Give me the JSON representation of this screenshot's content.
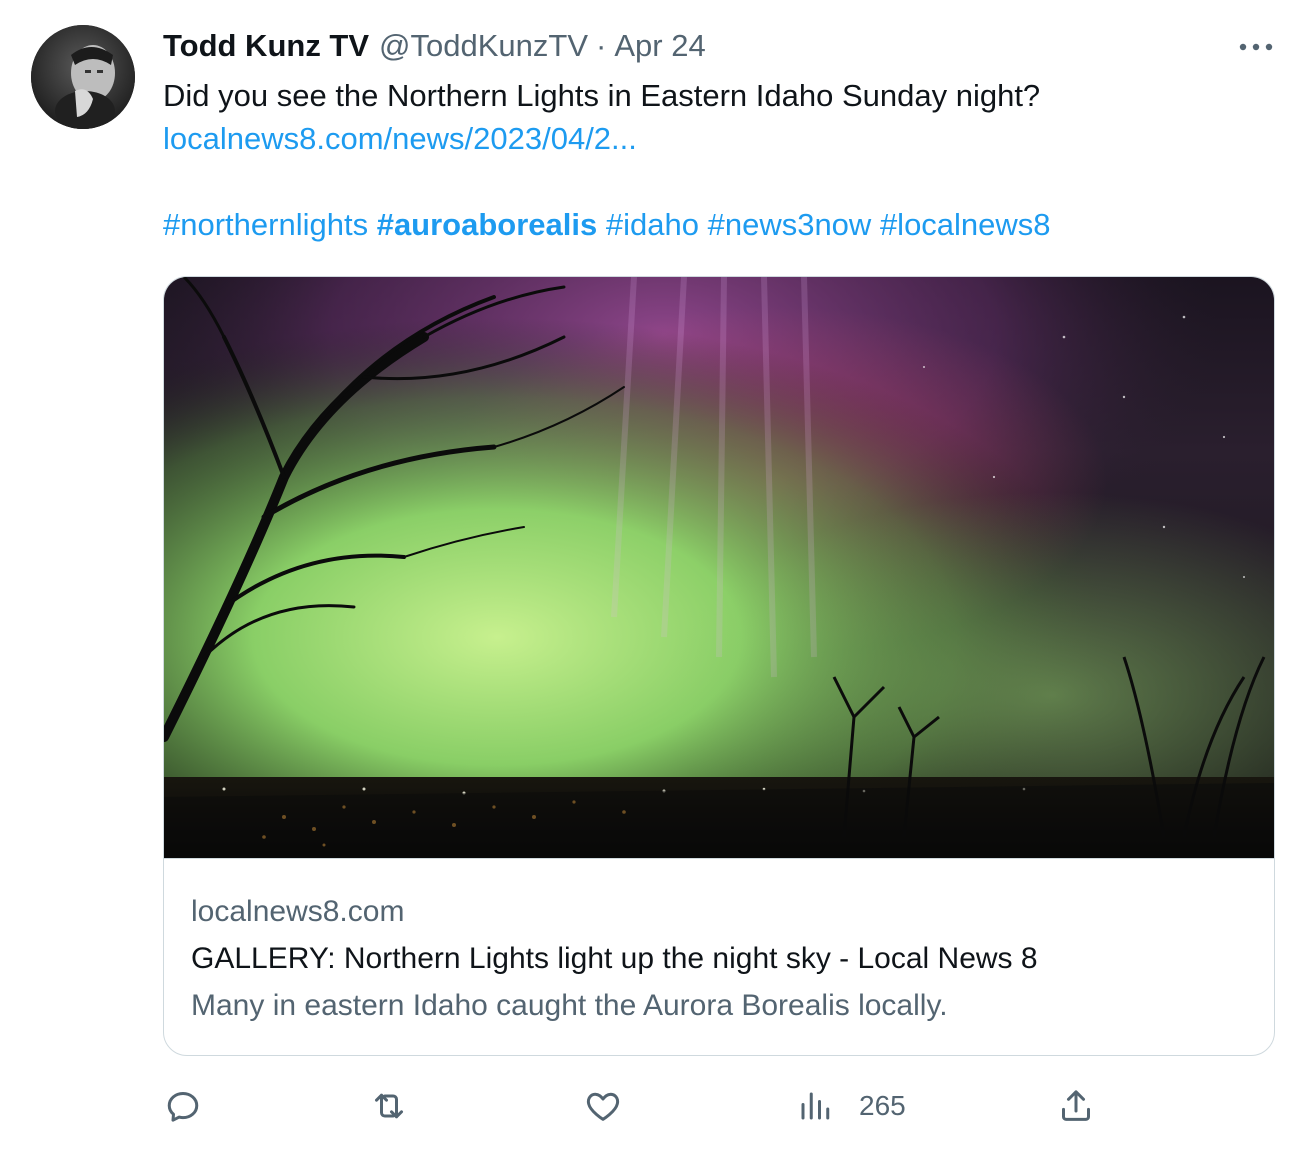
{
  "tweet": {
    "display_name": "Todd Kunz TV",
    "handle": "@ToddKunzTV",
    "separator": "·",
    "date": "Apr 24",
    "text_line1": "Did you see the Northern Lights in Eastern Idaho Sunday night?",
    "link": "localnews8.com/news/2023/04/2...",
    "hashtags": [
      "#northernlights",
      "#auroaborealis",
      "#idaho",
      "#news3now",
      "#localnews8"
    ]
  },
  "card": {
    "domain": "localnews8.com",
    "title": "GALLERY: Northern Lights light up the night sky - Local News 8",
    "description": "Many in eastern Idaho caught the Aurora Borealis locally."
  },
  "actions": {
    "views_count": "265"
  },
  "colors": {
    "link_blue": "#1d9bf0",
    "text_primary": "#0f1419",
    "text_secondary": "#536471",
    "border": "#cfd9de"
  },
  "icons": {
    "more": "more-horizontal-icon",
    "reply": "reply-icon",
    "retweet": "retweet-icon",
    "like": "heart-icon",
    "views": "views-chart-icon",
    "share": "share-icon"
  }
}
